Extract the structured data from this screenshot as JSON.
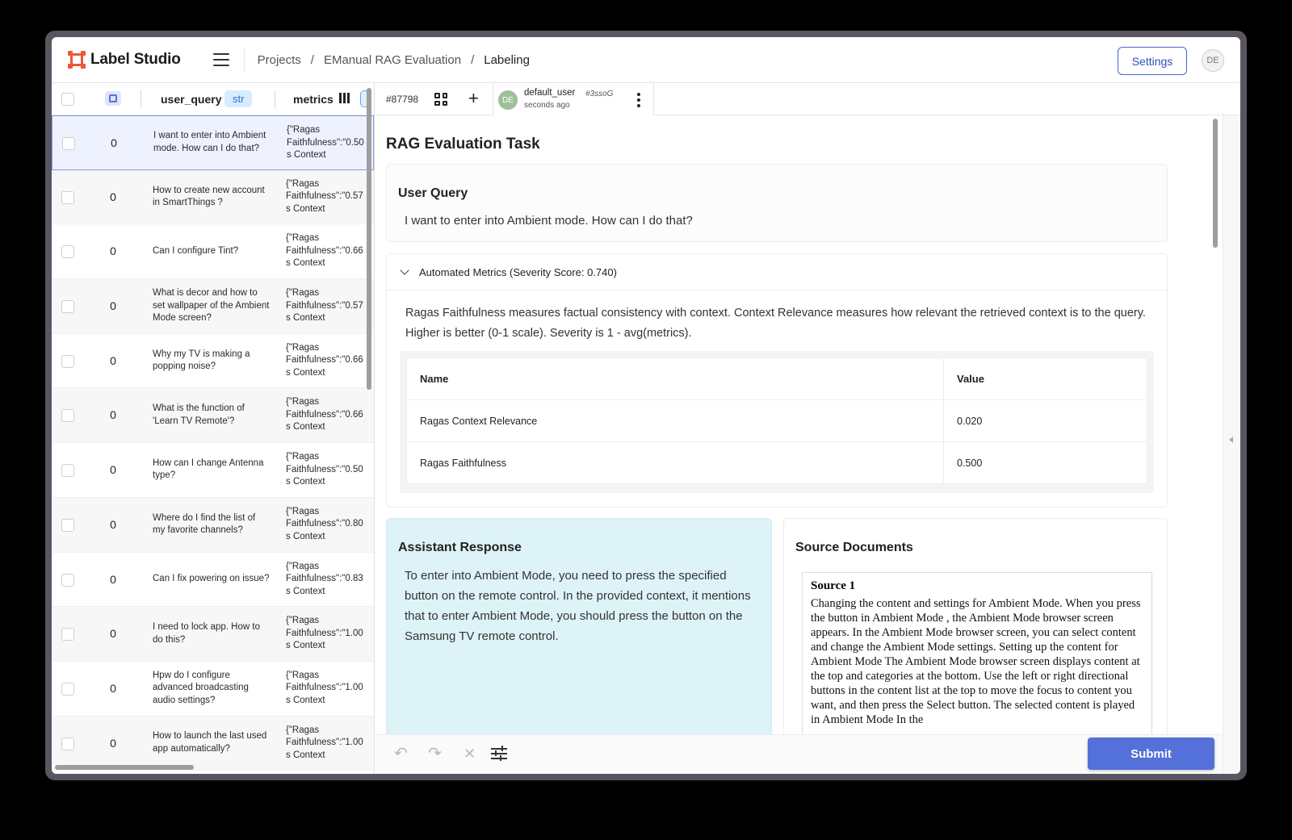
{
  "app": {
    "name": "Label Studio",
    "brand_color": "#f0563b",
    "accent_color": "#5470d9"
  },
  "breadcrumb": {
    "items": [
      "Projects",
      "EManual RAG Evaluation",
      "Labeling"
    ],
    "separator": "/"
  },
  "topbar": {
    "settings_label": "Settings",
    "avatar_initials": "DE"
  },
  "table": {
    "headers": {
      "user_query": "user_query",
      "user_query_type": "str",
      "metrics": "metrics"
    },
    "rows": [
      {
        "num": "0",
        "query": "I want to enter into Ambient mode. How can I do that?",
        "metrics": "{\"Ragas\nFaithfulness\":\"0.50\ns Context"
      },
      {
        "num": "0",
        "query": "How to create new account in SmartThings ?",
        "metrics": "{\"Ragas\nFaithfulness\":\"0.57\ns Context"
      },
      {
        "num": "0",
        "query": "Can I configure Tint?",
        "metrics": "{\"Ragas\nFaithfulness\":\"0.66\ns Context"
      },
      {
        "num": "0",
        "query": "What is decor and how to set wallpaper of the Ambient Mode screen?",
        "metrics": "{\"Ragas\nFaithfulness\":\"0.57\ns Context"
      },
      {
        "num": "0",
        "query": "Why my TV is making a popping noise?",
        "metrics": "{\"Ragas\nFaithfulness\":\"0.66\ns Context"
      },
      {
        "num": "0",
        "query": "What is the function of 'Learn TV Remote'?",
        "metrics": "{\"Ragas\nFaithfulness\":\"0.66\ns Context"
      },
      {
        "num": "0",
        "query": "How can I change Antenna type?",
        "metrics": "{\"Ragas\nFaithfulness\":\"0.50\ns Context"
      },
      {
        "num": "0",
        "query": "Where do I find the list of my favorite channels?",
        "metrics": "{\"Ragas\nFaithfulness\":\"0.80\ns Context"
      },
      {
        "num": "0",
        "query": "Can I fix powering on issue?",
        "metrics": "{\"Ragas\nFaithfulness\":\"0.83\ns Context"
      },
      {
        "num": "0",
        "query": "I need to lock app. How to do this?",
        "metrics": "{\"Ragas\nFaithfulness\":\"1.00\ns Context"
      },
      {
        "num": "0",
        "query": "Hpw do I configure advanced broadcasting audio settings?",
        "metrics": "{\"Ragas\nFaithfulness\":\"1.00\ns Context"
      },
      {
        "num": "0",
        "query": "How to launch the last used app automatically?",
        "metrics": "{\"Ragas\nFaithfulness\":\"1.00\ns Context"
      }
    ]
  },
  "task": {
    "id": "#87798",
    "annotator": {
      "initials": "DE",
      "name": "default_user",
      "hash": "#3ssoG",
      "time": "seconds ago"
    },
    "title": "RAG Evaluation Task",
    "user_query": {
      "heading": "User Query",
      "text": "I want to enter into Ambient mode. How can I do that?"
    },
    "metrics": {
      "header": "Automated Metrics (Severity Score: 0.740)",
      "description": "Ragas Faithfulness measures factual consistency with context. Context Relevance measures how relevant the retrieved context is to the query. Higher is better (0-1 scale). Severity is 1 - avg(metrics).",
      "columns": [
        "Name",
        "Value"
      ],
      "rows": [
        {
          "name": "Ragas Context Relevance",
          "value": "0.020"
        },
        {
          "name": "Ragas Faithfulness",
          "value": "0.500"
        }
      ]
    },
    "response": {
      "heading": "Assistant Response",
      "text": "To enter into Ambient Mode, you need to press the specified button on the remote control. In the provided context, it mentions that to enter Ambient Mode, you should press the button on the Samsung TV remote control."
    },
    "sources": {
      "heading": "Source Documents",
      "label": "Source 1",
      "text": "Changing the content and settings for Ambient Mode. When you press the button in Ambient Mode , the Ambient Mode browser screen appears. In the Ambient Mode browser screen, you can select content and change the Ambient Mode settings. Setting up the content for Ambient Mode The Ambient Mode browser screen displays content at the top and categories at the bottom. Use the left or right directional buttons in the content list at the top to move the focus to content you want, and then press the Select button. The selected content is played in Ambient Mode In the"
    },
    "submit_label": "Submit"
  }
}
